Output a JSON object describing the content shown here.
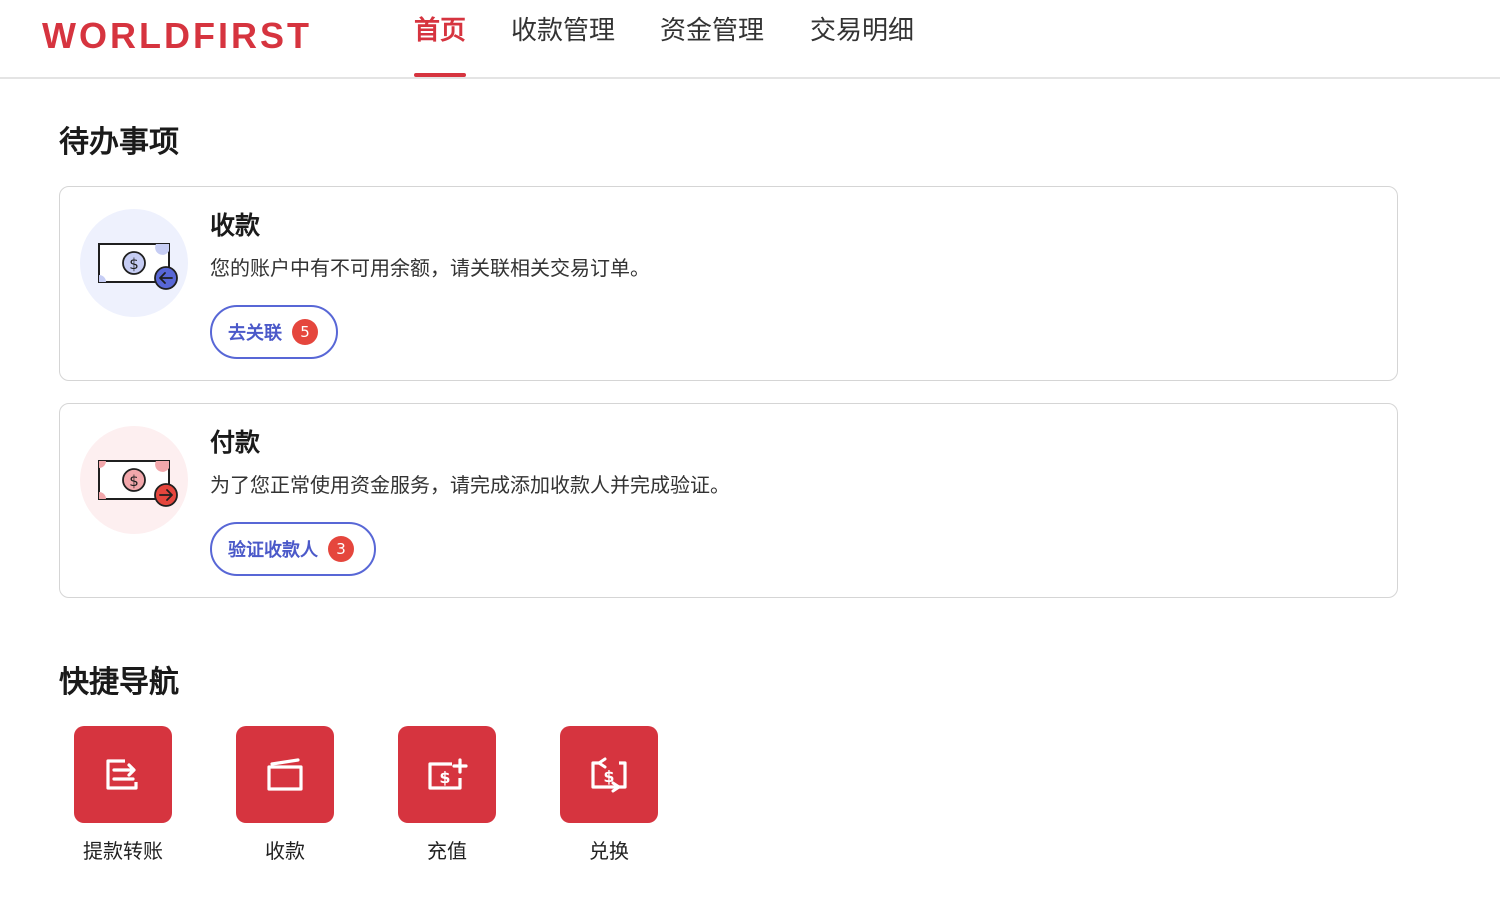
{
  "brand": {
    "logo_text": "WORLDFIRST",
    "accent": "#d6343f",
    "link_color": "#4b59c9"
  },
  "nav": {
    "tabs": [
      {
        "label": "首页",
        "active": true
      },
      {
        "label": "收款管理",
        "active": false
      },
      {
        "label": "资金管理",
        "active": false
      },
      {
        "label": "交易明细",
        "active": false
      }
    ]
  },
  "todo": {
    "title": "待办事项",
    "cards": [
      {
        "title": "收款",
        "description": "您的账户中有不可用余额，请关联相关交易订单。",
        "button_label": "去关联",
        "badge_count": "5",
        "icon": "money-receive-icon"
      },
      {
        "title": "付款",
        "description": "为了您正常使用资金服务，请完成添加收款人并完成验证。",
        "button_label": "验证收款人",
        "badge_count": "3",
        "icon": "money-send-icon"
      }
    ]
  },
  "quick_nav": {
    "title": "快捷导航",
    "items": [
      {
        "label": "提款转账",
        "icon": "withdraw-transfer-icon"
      },
      {
        "label": "收款",
        "icon": "receive-wallet-icon"
      },
      {
        "label": "充值",
        "icon": "top-up-icon"
      },
      {
        "label": "兑换",
        "icon": "exchange-icon"
      }
    ]
  }
}
